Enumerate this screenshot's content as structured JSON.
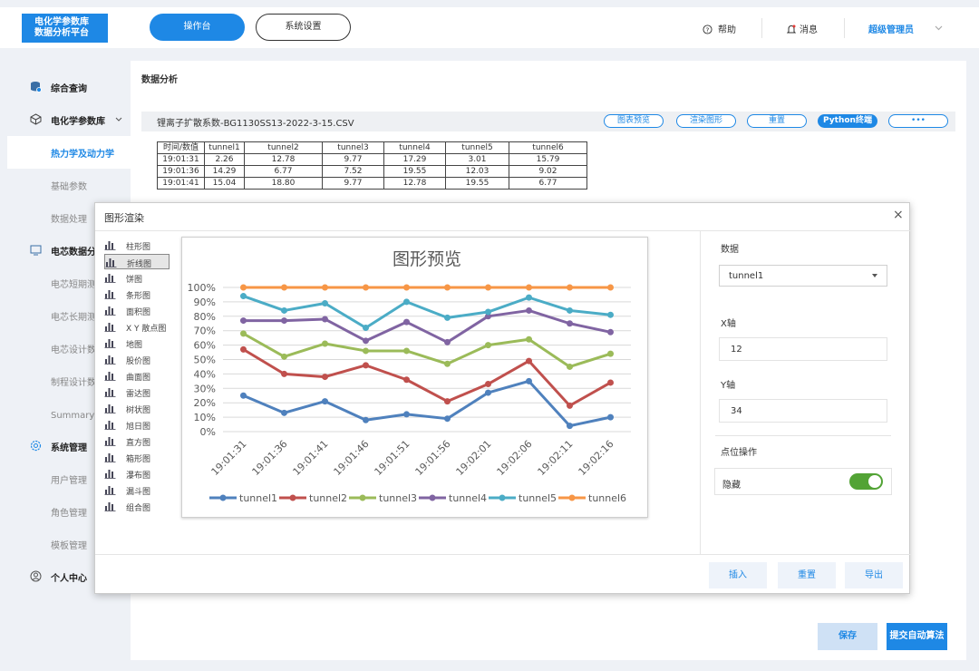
{
  "header": {
    "logo_line1": "电化学参数库",
    "logo_line2": "数据分析平台",
    "tab_console": "操作台",
    "tab_settings": "系统设置",
    "help": "帮助",
    "messages": "消息",
    "user": "超级管理员"
  },
  "sidebar": {
    "items": [
      {
        "label": "综合查询",
        "icon": "database-icon"
      },
      {
        "label": "电化学参数库",
        "icon": "cube-icon"
      },
      {
        "label": "热力学及动力学"
      },
      {
        "label": "基础参数"
      },
      {
        "label": "数据处理"
      },
      {
        "label": "电芯数据分析",
        "icon": "monitor-icon"
      },
      {
        "label": "电芯短期测试"
      },
      {
        "label": "电芯长期测试"
      },
      {
        "label": "电芯设计数据"
      },
      {
        "label": "制程设计数据"
      },
      {
        "label": "Summary数据"
      },
      {
        "label": "系统管理",
        "icon": "gear-icon"
      },
      {
        "label": "用户管理"
      },
      {
        "label": "角色管理"
      },
      {
        "label": "模板管理"
      },
      {
        "label": "个人中心",
        "icon": "person-icon"
      }
    ]
  },
  "main": {
    "title": "数据分析",
    "filename": "锂离子扩散系数-BG1130SS13-2022-3-15.CSV",
    "buttons": {
      "chart_preview": "图表预览",
      "render_chart": "渲染图形",
      "reset": "重置",
      "python_terminal": "Python终端",
      "more": "•••"
    }
  },
  "table": {
    "headers": [
      "时间/数值",
      "tunnel1",
      "tunnel2",
      "tunnel3",
      "tunnel4",
      "tunnel5",
      "tunnel6"
    ],
    "rows": [
      [
        "19:01:31",
        "2.26",
        "12.78",
        "9.77",
        "17.29",
        "3.01",
        "15.79"
      ],
      [
        "19:01:36",
        "14.29",
        "6.77",
        "7.52",
        "19.55",
        "12.03",
        "9.02"
      ],
      [
        "19:01:41",
        "15.04",
        "18.80",
        "9.77",
        "12.78",
        "19.55",
        "6.77"
      ]
    ]
  },
  "modal": {
    "title": "图形渲染",
    "close": "×",
    "chart_types": [
      "柱形图",
      "折线图",
      "饼图",
      "条形图",
      "面积图",
      "X Y 散点图",
      "地图",
      "股价图",
      "曲面图",
      "雷达图",
      "树状图",
      "旭日图",
      "直方图",
      "箱形图",
      "瀑布图",
      "漏斗图",
      "组合图"
    ],
    "chart_type_icons": [
      "column-chart-icon",
      "line-chart-icon",
      "pie-chart-icon",
      "bar-chart-icon",
      "area-chart-icon",
      "scatter-chart-icon",
      "map-icon",
      "stock-chart-icon",
      "surface-chart-icon",
      "radar-chart-icon",
      "treemap-icon",
      "sunburst-icon",
      "histogram-icon",
      "boxplot-icon",
      "waterfall-icon",
      "funnel-icon",
      "combo-chart-icon"
    ],
    "selected_chart_type": "折线图",
    "right": {
      "data_label": "数据",
      "data_value": "tunnel1",
      "x_label": "X轴",
      "x_value": "12",
      "y_label": "Y轴",
      "y_value": "34",
      "point_op_label": "点位操作",
      "hide_label": "隐藏",
      "hide_on": true
    },
    "footer": {
      "insert": "插入",
      "reset": "重置",
      "export": "导出"
    }
  },
  "actions": {
    "save": "保存",
    "submit": "提交自动算法"
  },
  "chart_data": {
    "type": "line",
    "title": "图形预览",
    "categories": [
      "19:01:31",
      "19:01:36",
      "19:01:41",
      "19:01:46",
      "19:01:51",
      "19:01:56",
      "19:02:01",
      "19:02:06",
      "19:02:11",
      "19:02:16"
    ],
    "ylim": [
      0,
      100
    ],
    "yticks": [
      "0%",
      "10%",
      "20%",
      "30%",
      "40%",
      "50%",
      "60%",
      "70%",
      "80%",
      "90%",
      "100%"
    ],
    "series": [
      {
        "name": "tunnel1",
        "color": "#4f81bd",
        "values": [
          25,
          13,
          21,
          8,
          12,
          9,
          27,
          35,
          4,
          10
        ]
      },
      {
        "name": "tunnel2",
        "color": "#c0504d",
        "values": [
          57,
          40,
          38,
          46,
          36,
          21,
          33,
          49,
          18,
          34
        ]
      },
      {
        "name": "tunnel3",
        "color": "#9bbb59",
        "values": [
          68,
          52,
          61,
          56,
          56,
          47,
          60,
          64,
          45,
          54
        ]
      },
      {
        "name": "tunnel4",
        "color": "#8064a2",
        "values": [
          77,
          77,
          78,
          63,
          76,
          62,
          80,
          84,
          75,
          69
        ]
      },
      {
        "name": "tunnel5",
        "color": "#4bacc6",
        "values": [
          94,
          84,
          89,
          72,
          90,
          79,
          83,
          93,
          84,
          81
        ]
      },
      {
        "name": "tunnel6",
        "color": "#f79646",
        "values": [
          100,
          100,
          100,
          100,
          100,
          100,
          100,
          100,
          100,
          100
        ]
      }
    ],
    "legend": "bottom",
    "grid": true
  }
}
